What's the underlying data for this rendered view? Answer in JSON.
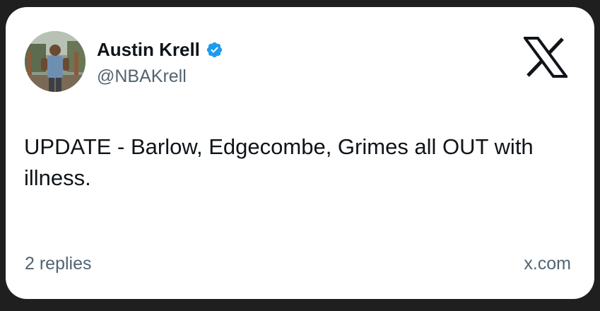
{
  "author": {
    "display_name": "Austin Krell",
    "handle": "@NBAKrell",
    "verified": true,
    "avatar_icon": "profile-photo"
  },
  "tweet": {
    "text": "UPDATE - Barlow, Edgecombe, Grimes all OUT with illness."
  },
  "footer": {
    "replies": "2 replies",
    "source": "x.com"
  },
  "icons": {
    "verified": "verified-badge-icon",
    "brand": "x-logo-icon"
  },
  "colors": {
    "text_primary": "#0f1419",
    "text_secondary": "#536471",
    "verified_blue": "#1d9bf0",
    "card_background": "#ffffff",
    "page_background": "#1f1f1f"
  }
}
